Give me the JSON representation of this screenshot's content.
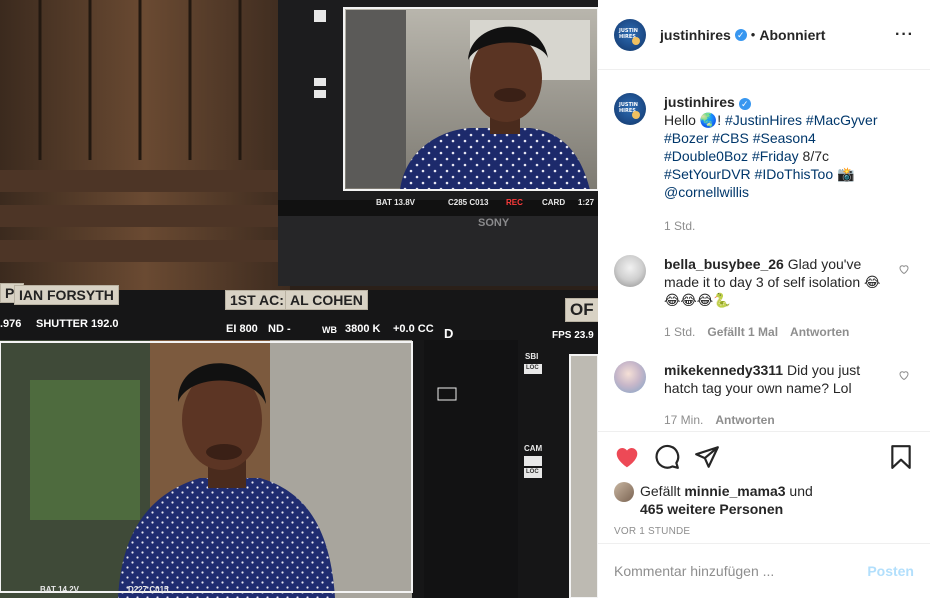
{
  "photo": {
    "alt_tape_1": "IAN FORSYTH",
    "alt_tape_2": "1ST AC:",
    "alt_tape_3": "AL COHEN",
    "tape_left": "P:",
    "tape_right": "OF",
    "monitor_top": {
      "bat": "BAT 13.8V",
      "codes": "C285 C013",
      "rec": "REC",
      "card": "CARD",
      "time": "1:27",
      "brand": "SONY"
    },
    "monitor_bottom": {
      "left_value": ".976",
      "shutter": "SHUTTER 192.0",
      "ei": "EI 800",
      "nd": "ND -",
      "wb": "WB",
      "kelvin": "3800 K",
      "cc": "+0.0 CC",
      "d": "D",
      "fps": "FPS 23.9",
      "bat": "BAT 14.2V",
      "codes": "D227 C015",
      "sbi": "SBI",
      "loc1": "LOC",
      "cam": "CAM",
      "loc2": "LOC"
    }
  },
  "header": {
    "username": "justinhires",
    "separator": "•",
    "follow_status": "Abonniert",
    "more": "···"
  },
  "caption": {
    "username": "justinhires",
    "text_hello": "Hello",
    "globe": "🌏",
    "exclaim": "! ",
    "tags": "#JustinHires #MacGyver #Bozer #CBS #Season4 #Double0Boz #Friday",
    "text_mid": " 8/7c ",
    "tags2": "#SetYourDVR #IDoThisToo",
    "camera": "📸",
    "mention": "@cornellwillis",
    "time": "1 Std."
  },
  "comments": [
    {
      "username": "bella_busybee_26",
      "text": "Glad you've made it to day 3 of self isolation 😂😂😂😂🐍",
      "time": "1 Std.",
      "likes": "Gefällt 1 Mal",
      "reply": "Antworten"
    },
    {
      "username": "mikekennedy3311",
      "text": "Did you just hatch tag your own name? Lol",
      "time": "17 Min.",
      "reply": "Antworten"
    }
  ],
  "likes": {
    "prefix": "Gefällt",
    "user": "minnie_mama3",
    "und": "und",
    "others": "465 weitere Personen"
  },
  "timestamp": "VOR 1 STUNDE",
  "add_comment": {
    "placeholder": "Kommentar hinzufügen ...",
    "post": "Posten"
  },
  "colors": {
    "verified": "#3897f0",
    "liked_heart": "#ed4956",
    "hashtag": "#00376b",
    "post_disabled": "#b2dffc"
  }
}
